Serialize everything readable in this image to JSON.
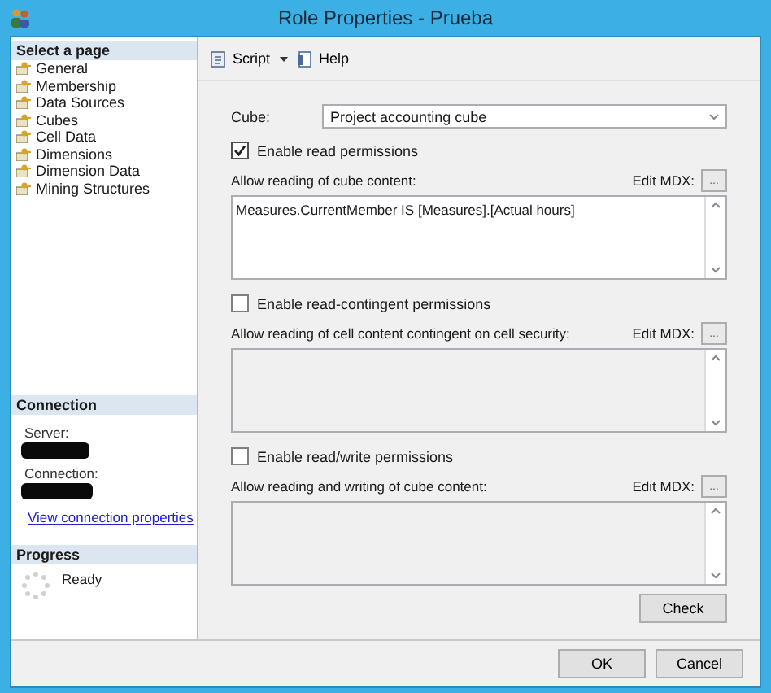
{
  "window": {
    "title": "Role Properties - Prueba"
  },
  "sidebar": {
    "header": "Select a page",
    "items": [
      {
        "label": "General"
      },
      {
        "label": "Membership"
      },
      {
        "label": "Data Sources"
      },
      {
        "label": "Cubes"
      },
      {
        "label": "Cell Data"
      },
      {
        "label": "Dimensions"
      },
      {
        "label": "Dimension Data"
      },
      {
        "label": "Mining Structures"
      }
    ]
  },
  "connection": {
    "header": "Connection",
    "server_label": "Server:",
    "connection_label": "Connection:",
    "link": "View connection properties"
  },
  "progress": {
    "header": "Progress",
    "status": "Ready"
  },
  "toolbar": {
    "script": "Script",
    "help": "Help"
  },
  "cube": {
    "label": "Cube:",
    "value": "Project accounting cube"
  },
  "sections": [
    {
      "checkbox": "Enable read permissions",
      "checked": true,
      "area_label": "Allow reading of cube content:",
      "edit_label": "Edit MDX:",
      "edit_button": "...",
      "content": "Measures.CurrentMember IS [Measures].[Actual hours]"
    },
    {
      "checkbox": "Enable read-contingent permissions",
      "checked": false,
      "area_label": "Allow reading of cell content contingent on cell security:",
      "edit_label": "Edit MDX:",
      "edit_button": "..."
    },
    {
      "checkbox": "Enable read/write permissions",
      "checked": false,
      "area_label": "Allow reading and writing of cube content:",
      "edit_label": "Edit MDX:",
      "edit_button": "..."
    }
  ],
  "check_button": "Check",
  "buttons": [
    "OK",
    "Cancel"
  ]
}
